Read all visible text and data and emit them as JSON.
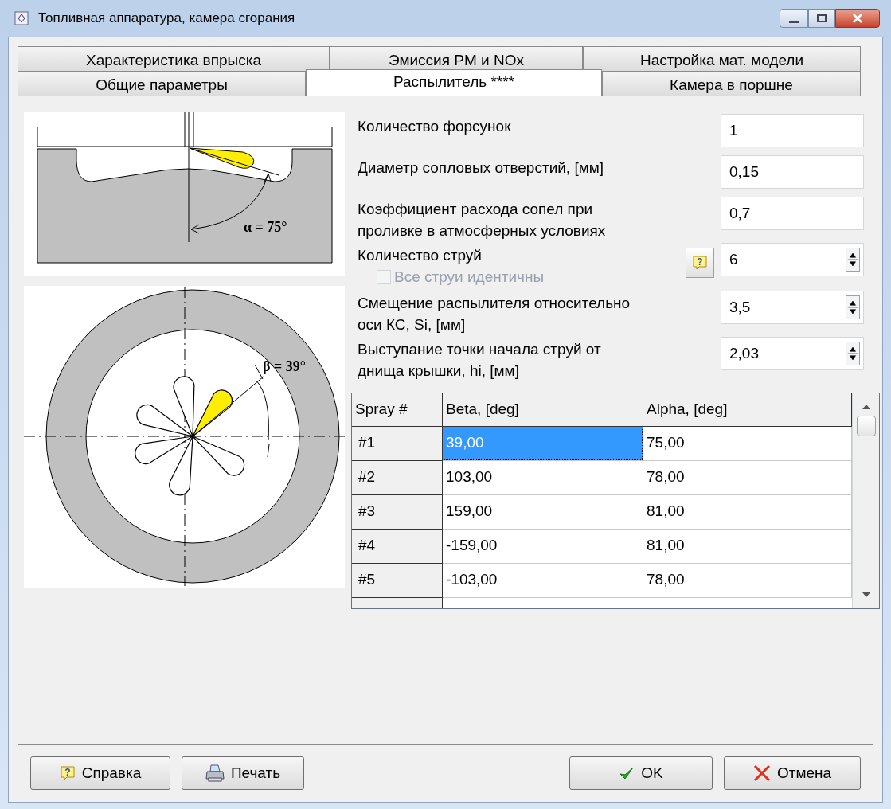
{
  "window": {
    "title": "Топливная аппаратура, камера сгорания"
  },
  "tab_rows": [
    [
      {
        "label": "Характеристика впрыска",
        "selected": false
      },
      {
        "label": "Эмиссия PM и NOx",
        "selected": false
      },
      {
        "label": "Настройка мат. модели",
        "selected": false
      }
    ],
    [
      {
        "label": "Общие параметры",
        "selected": false
      },
      {
        "label": "Распылитель ****",
        "selected": true
      },
      {
        "label": "Камера в поршне",
        "selected": false
      }
    ]
  ],
  "help_glyph": "?",
  "diagrams": {
    "side_view_label": "α = 75°",
    "top_view_label": "β = 39°"
  },
  "fields": [
    {
      "kind": "text",
      "label": "Количество форсунок",
      "value": "1"
    },
    {
      "kind": "text",
      "label": "Диаметр сопловых отверстий, [мм]",
      "value": "0,15"
    },
    {
      "kind": "text",
      "label": "Коэффициент расхода сопел при\nпроливке в атмосферных условиях",
      "value": "0,7"
    },
    {
      "kind": "spinner_help",
      "label": "Количество струй",
      "value": "6",
      "checkbox": {
        "label": "Все струи идентичны",
        "checked": false,
        "disabled": true
      }
    },
    {
      "kind": "spinner",
      "label": "Смещение распылителя относительно\nоси КС, Si, [мм]",
      "value": "3,5"
    },
    {
      "kind": "spinner",
      "label": "Выступание точки начала струй от\nднища крышки, hi, [мм]",
      "value": "2,03"
    }
  ],
  "table": {
    "columns": [
      "Spray #",
      "Beta, [deg]",
      "Alpha, [deg]"
    ],
    "rows": [
      {
        "label": "#1",
        "beta": "39,00",
        "alpha": "75,00",
        "selected": true
      },
      {
        "label": "#2",
        "beta": "103,00",
        "alpha": "78,00",
        "selected": false
      },
      {
        "label": "#3",
        "beta": "159,00",
        "alpha": "81,00",
        "selected": false
      },
      {
        "label": "#4",
        "beta": "-159,00",
        "alpha": "81,00",
        "selected": false
      },
      {
        "label": "#5",
        "beta": "-103,00",
        "alpha": "78,00",
        "selected": false
      }
    ]
  },
  "buttons": [
    {
      "kind": "help",
      "label": "Справка"
    },
    {
      "kind": "print",
      "label": "Печать"
    },
    {
      "kind": "ok",
      "label": "OK"
    },
    {
      "kind": "cancel",
      "label": "Отмена"
    }
  ]
}
